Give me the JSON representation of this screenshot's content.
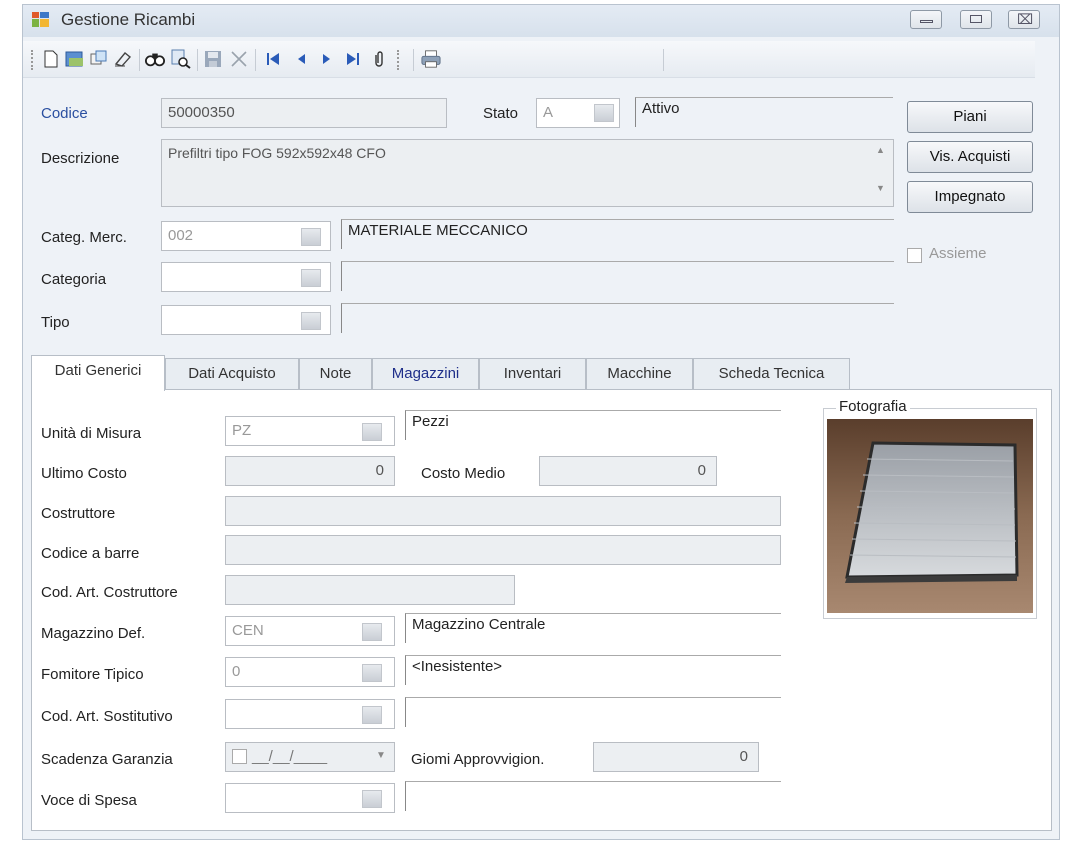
{
  "window": {
    "title": "Gestione Ricambi",
    "controls": {
      "minimize_icon": "minimize-icon",
      "maximize_icon": "maximize-icon",
      "close_icon": "close-icon",
      "close_glyph": "⌧"
    }
  },
  "toolbar": {
    "icons": [
      {
        "name": "new-document-icon",
        "glyph": "🗋"
      },
      {
        "name": "open-icon",
        "glyph": "🗁"
      },
      {
        "name": "copy-icon",
        "glyph": "⧉"
      },
      {
        "name": "eraser-icon",
        "glyph": "⌫"
      },
      {
        "name": "find-icon",
        "glyph": "🔭"
      },
      {
        "name": "find-next-icon",
        "glyph": "🔎"
      },
      {
        "name": "save-icon",
        "glyph": "💾"
      },
      {
        "name": "delete-icon",
        "glyph": "✕"
      },
      {
        "name": "first-record-icon",
        "glyph": "⏮"
      },
      {
        "name": "previous-record-icon",
        "glyph": "◀"
      },
      {
        "name": "next-record-icon",
        "glyph": "▶"
      },
      {
        "name": "last-record-icon",
        "glyph": "⏭"
      },
      {
        "name": "attachment-icon",
        "glyph": "📎"
      },
      {
        "name": "print-icon",
        "glyph": "🖶"
      }
    ]
  },
  "header": {
    "codice_label": "Codice",
    "codice_value": "50000350",
    "stato_label": "Stato",
    "stato_code": "A",
    "stato_desc": "Attivo",
    "descrizione_label": "Descrizione",
    "descrizione_value": "Prefiltri tipo FOG 592x592x48 CFO",
    "categ_merc_label": "Categ. Merc.",
    "categ_merc_code": "002",
    "categ_merc_desc": "MATERIALE MECCANICO",
    "categoria_label": "Categoria",
    "categoria_code": "",
    "categoria_desc": "",
    "tipo_label": "Tipo",
    "tipo_code": "",
    "tipo_desc": "",
    "assieme_label": "Assieme"
  },
  "buttons": {
    "piani": "Piani",
    "vis_acquisti": "Vis. Acquisti",
    "impegnato": "Impegnato"
  },
  "tabs": [
    "Dati Generici",
    "Dati Acquisto",
    "Note",
    "Magazzini",
    "Inventari",
    "Macchine",
    "Scheda Tecnica"
  ],
  "dati_generici": {
    "unita_misura_label": "Unità di Misura",
    "unita_misura_code": "PZ",
    "unita_misura_desc": "Pezzi",
    "ultimo_costo_label": "Ultimo Costo",
    "ultimo_costo_value": "0",
    "costo_medio_label": "Costo Medio",
    "costo_medio_value": "0",
    "costruttore_label": "Costruttore",
    "costruttore_value": "",
    "codice_barre_label": "Codice a barre",
    "codice_barre_value": "",
    "cod_art_costruttore_label": "Cod. Art. Costruttore",
    "cod_art_costruttore_value": "",
    "magazzino_def_label": "Magazzino Def.",
    "magazzino_def_code": "CEN",
    "magazzino_def_desc": "Magazzino Centrale",
    "fornitore_label": "Fomitore Tipico",
    "fornitore_code": "0",
    "fornitore_desc": "<Inesistente>",
    "cod_art_sostitutivo_label": "Cod. Art. Sostitutivo",
    "cod_art_sostitutivo_code": "",
    "cod_art_sostitutivo_desc": "",
    "scadenza_label": "Scadenza Garanzia",
    "scadenza_value": "__/__/____",
    "giorni_label": "Giomi Approvvigion.",
    "giorni_value": "0",
    "voce_spesa_label": "Voce di Spesa",
    "voce_spesa_code": "",
    "voce_spesa_desc": "",
    "fotografia_label": "Fotografia"
  },
  "colors": {
    "window_bg": "#eef2f7",
    "label_blue": "#2a4fa0",
    "tab_blue": "#1f2f8a"
  }
}
